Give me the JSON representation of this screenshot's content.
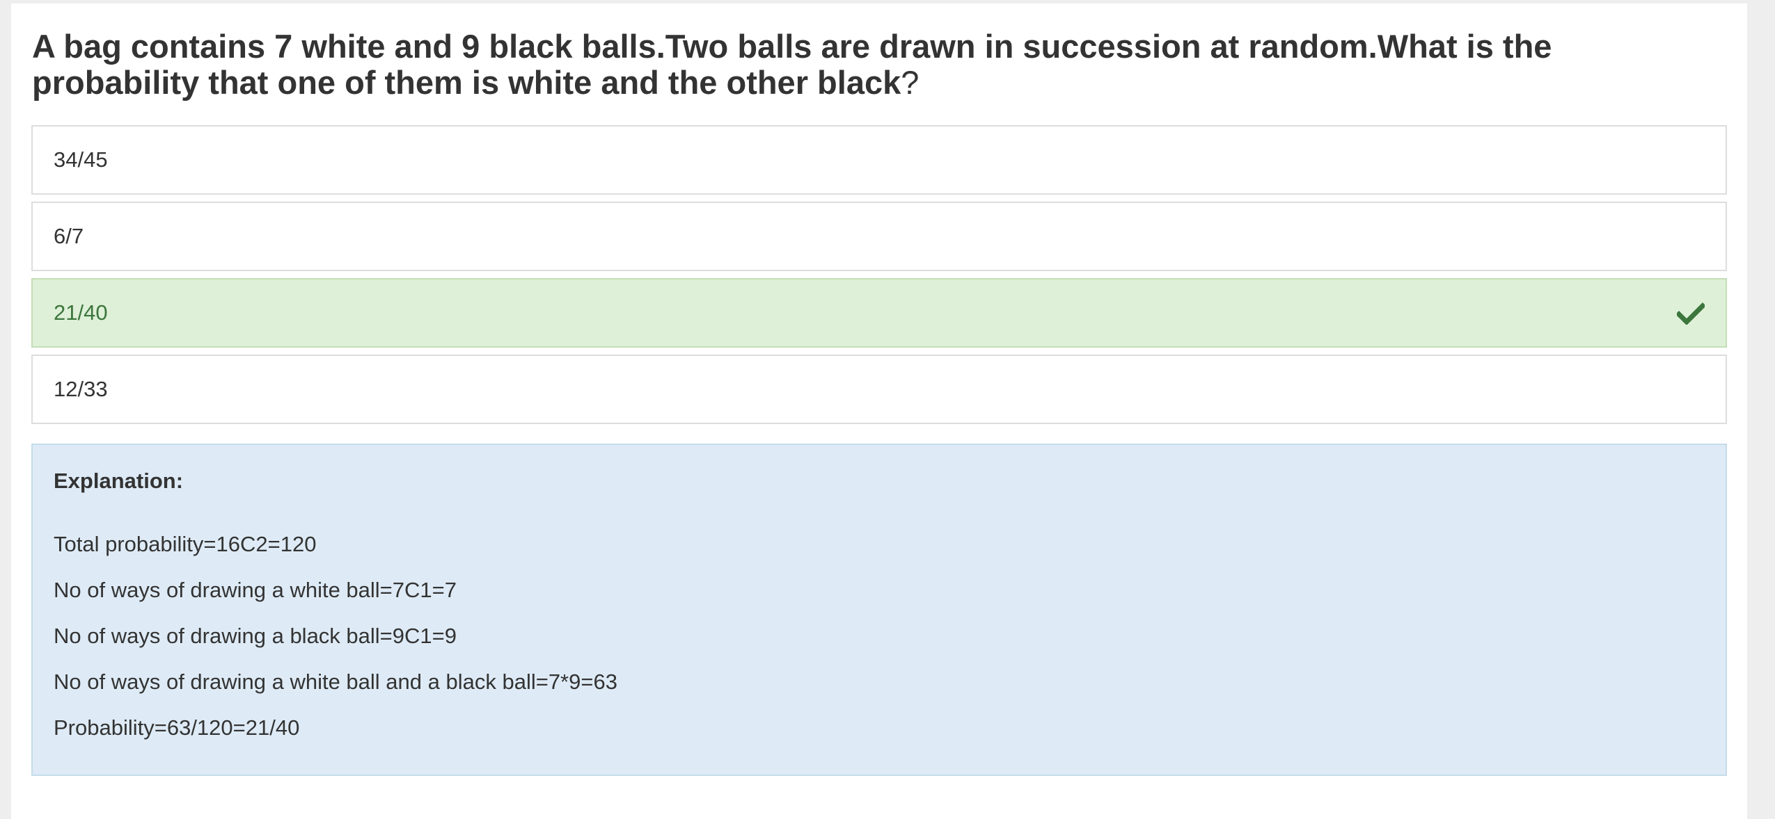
{
  "question": {
    "text": "A bag contains 7 white and 9 black balls.Two balls are drawn in succession at random.What is the probability that one of them is white and the other black",
    "mark": "?"
  },
  "options": [
    {
      "label": "34/45",
      "correct": false
    },
    {
      "label": "6/7",
      "correct": false
    },
    {
      "label": "21/40",
      "correct": true
    },
    {
      "label": "12/33",
      "correct": false
    }
  ],
  "explanation": {
    "title": "Explanation:",
    "lines": [
      "Total probability=16C2=120",
      "No of ways of drawing a white ball=7C1=7",
      "No of ways of drawing a black ball=9C1=9",
      "No of ways of drawing a white ball and a black ball=7*9=63",
      "Probability=63/120=21/40"
    ]
  },
  "icons": {
    "correct_indicator": "check-icon"
  },
  "colors": {
    "correct_bg": "#dff0d8",
    "correct_text": "#3c763d",
    "explanation_bg": "#deebf6"
  }
}
